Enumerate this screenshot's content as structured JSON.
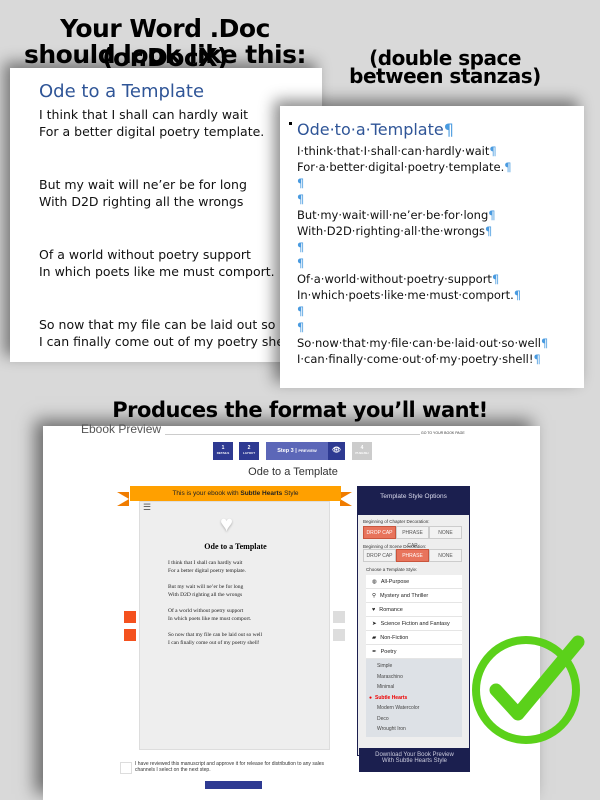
{
  "headings": {
    "line1": "Your Word .Doc (or.DocX)",
    "line2": "should look like this:",
    "note1": "(double space",
    "note2": "between stanzas)",
    "produces": "Produces the format you’ll want!"
  },
  "poem": {
    "title": "Ode to a Template",
    "lines": [
      "I think that I shall can hardly wait",
      "For a better digital poetry template.",
      "But my wait will ne’er be for long",
      "With D2D righting all the wrongs",
      "Of a world without poetry support",
      "In which poets like me must comport.",
      "So now that my file can be laid out so well",
      "I can finally come out of my poetry shell!"
    ]
  },
  "marked": {
    "title": "Ode·to·a·Template",
    "pilcrow": "¶",
    "lines": [
      "I·think·that·I·shall·can·hardly·wait",
      "For·a·better·digital·poetry·template.",
      "",
      "",
      "But·my·wait·will·ne’er·be·for·long",
      "With·D2D·righting·all·the·wrongs",
      "",
      "",
      "Of·a·world·without·poetry·support",
      "In·which·poets·like·me·must·comport.",
      "",
      "",
      "So·now·that·my·file·can·be·laid·out·so·well",
      "I·can·finally·come·out·of·my·poetry·shell!"
    ]
  },
  "ui": {
    "page_title": "Ebook Preview",
    "go_link": "GO TO YOUR BOOK PAGE",
    "steps": [
      {
        "num": "1",
        "label": "DETAILS"
      },
      {
        "num": "2",
        "label": "LAYOUT"
      },
      {
        "num": "Step 3",
        "label": "PREVIEW"
      },
      {
        "num": "4",
        "label": "PUBLISH"
      }
    ],
    "book_title": "Ode to a Template",
    "banner_prefix": "This is your ebook with ",
    "banner_style": "Subtle Hearts",
    "banner_suffix": " Style",
    "panel_title": "Template Style Options",
    "chapter_label": "Beginning of Chapter Decoration:",
    "scene_label": "Beginning of Scene Decoration:",
    "options": [
      "DROP CAP",
      "PHRASE CAP",
      "NONE"
    ],
    "chapter_selected": "DROP CAP",
    "scene_selected": "PHRASE CAP",
    "choose_label": "Choose a Template Style:",
    "categories": [
      {
        "icon": "globe-icon",
        "glyph": "◍",
        "label": "All-Purpose"
      },
      {
        "icon": "search-icon",
        "glyph": "⚲",
        "label": "Mystery and Thriller"
      },
      {
        "icon": "heart-icon",
        "glyph": "♥",
        "label": "Romance"
      },
      {
        "icon": "spaceship-icon",
        "glyph": "➤",
        "label": "Science Fiction and Fantasy"
      },
      {
        "icon": "graduation-cap-icon",
        "glyph": "▰",
        "label": "Non-Fiction"
      },
      {
        "icon": "pen-icon",
        "glyph": "✒",
        "label": "Poetry"
      }
    ],
    "poetry_styles": [
      "Simple",
      "Maraschino",
      "Minimal",
      "Subtle Hearts",
      "Modern Watercolor",
      "Deco",
      "Wrought Iron"
    ],
    "selected_style": "Subtle Hearts",
    "download": "Download Your Book Preview With Subtle Hearts Style",
    "approve": "I have reviewed this manuscript and approve it for release for distribution to any sales channels I select on the next step.",
    "help_glyph": "?",
    "accent": "#2e3a92",
    "banner_color": "#ffa000",
    "panel_color": "#1b1f4f",
    "selected_color": "#e8745c"
  },
  "checkmark_color": "#5bd11a"
}
